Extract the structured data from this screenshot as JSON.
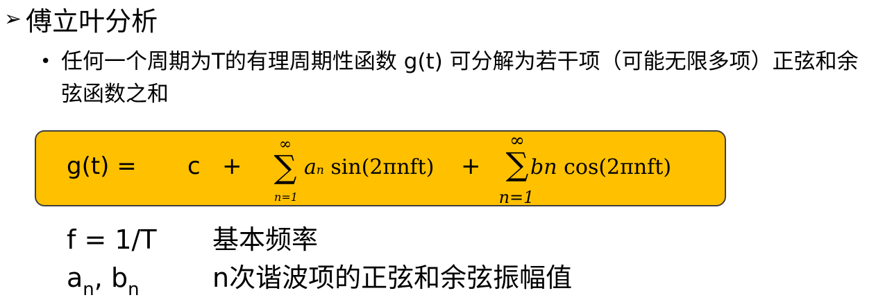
{
  "heading": {
    "marker": "➢",
    "title": "傅立叶分析"
  },
  "bullet": {
    "marker": "•",
    "text": "任何一个周期为T的有理周期性函数 g(t) 可分解为若干项（可能无限多项）正弦和余弦函数之和"
  },
  "formula": {
    "lhs": "g(t) =",
    "constant": "c",
    "plus": "+",
    "sum_upper": "∞",
    "sum_symbol": "∑",
    "sum_lower": "n=1",
    "coef_a": "a",
    "coef_a_sub": "n",
    "sin_term": "sin(2πnft)",
    "coef_b": "bn",
    "cos_term": "cos(2πnft)"
  },
  "definitions": [
    {
      "symbol": "f = 1/T",
      "description": "基本频率"
    },
    {
      "symbol_a": "a",
      "sub_a": "n",
      "separator": ", ",
      "symbol_b": "b",
      "sub_b": "n",
      "description": "n次谐波项的正弦和余弦振幅值"
    }
  ],
  "colors": {
    "formula_background": "#ffc000",
    "formula_border": "#3f3f3f",
    "text": "#000000"
  }
}
